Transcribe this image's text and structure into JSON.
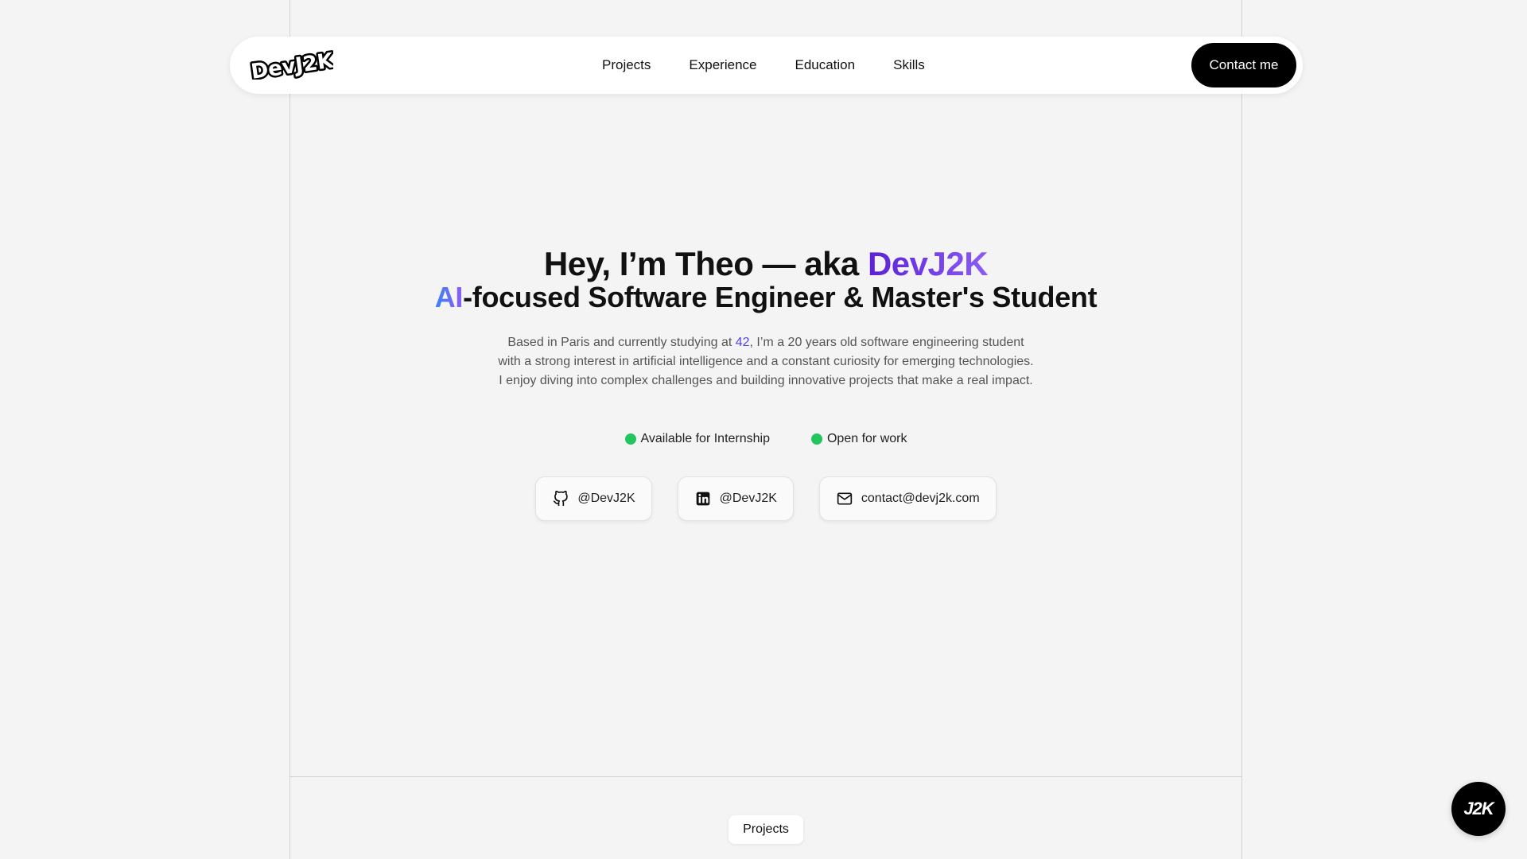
{
  "navbar": {
    "logo_text": "DevJ2K",
    "links": [
      "Projects",
      "Experience",
      "Education",
      "Skills"
    ],
    "contact_label": "Contact me"
  },
  "hero": {
    "title_prefix": "Hey, I’m Theo — aka ",
    "title_highlight": "DevJ2K",
    "subtitle_highlight": "AI",
    "subtitle_rest": "-focused Software Engineer & Master's Student",
    "desc_before": "Based in Paris and currently studying at ",
    "desc_highlight": "42",
    "desc_after": ", I’m a 20 years old software engineering student with a strong interest in artificial intelligence and a constant curiosity for emerging technologies. I enjoy diving into complex challenges and building innovative projects that make a real impact."
  },
  "status": [
    {
      "label": "Available for Internship",
      "color": "#22c55e"
    },
    {
      "label": "Open for work",
      "color": "#22c55e"
    }
  ],
  "social": [
    {
      "icon": "github-icon",
      "label": "@DevJ2K"
    },
    {
      "icon": "linkedin-icon",
      "label": "@DevJ2K"
    },
    {
      "icon": "mail-icon",
      "label": "contact@devj2k.com"
    }
  ],
  "section_tag": "Projects",
  "fab_label": "J2K",
  "colors": {
    "accent_start": "#5b21d6",
    "accent_end": "#8b5cf6",
    "status_green": "#22c55e",
    "link_blue": "#4f46e5"
  }
}
